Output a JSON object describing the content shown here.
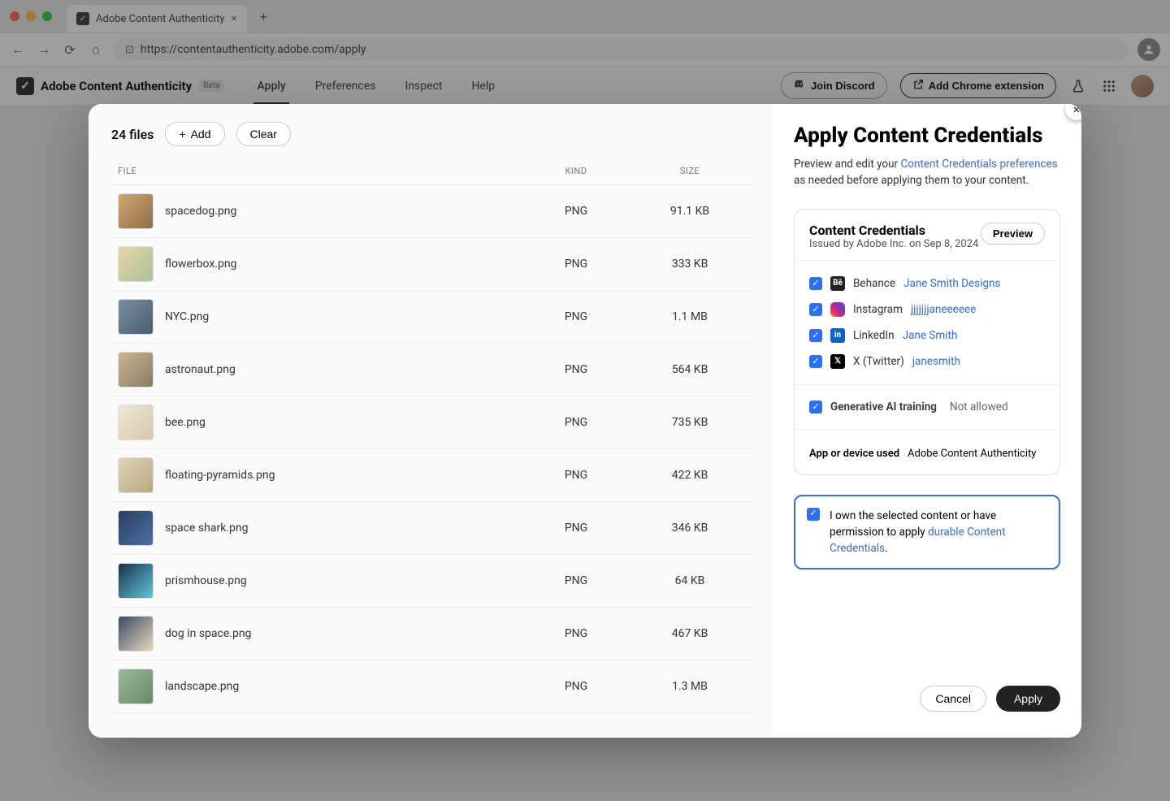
{
  "browser": {
    "tab_title": "Adobe Content Authenticity",
    "url": "https://contentauthenticity.adobe.com/apply"
  },
  "app": {
    "brand": "Adobe Content Authenticity",
    "beta": "Beta",
    "nav": [
      "Apply",
      "Preferences",
      "Inspect",
      "Help"
    ],
    "active_nav_index": 0,
    "join_discord": "Join Discord",
    "add_ext": "Add Chrome extension"
  },
  "modal": {
    "file_count": "24 files",
    "add_label": "Add",
    "clear_label": "Clear",
    "columns": {
      "file": "FILE",
      "kind": "KIND",
      "size": "SIZE"
    },
    "files": [
      {
        "name": "spacedog.png",
        "kind": "PNG",
        "size": "91.1 KB"
      },
      {
        "name": "flowerbox.png",
        "kind": "PNG",
        "size": "333 KB"
      },
      {
        "name": "NYC.png",
        "kind": "PNG",
        "size": "1.1 MB"
      },
      {
        "name": "astronaut.png",
        "kind": "PNG",
        "size": "564 KB"
      },
      {
        "name": "bee.png",
        "kind": "PNG",
        "size": "735 KB"
      },
      {
        "name": "floating-pyramids.png",
        "kind": "PNG",
        "size": "422 KB"
      },
      {
        "name": "space shark.png",
        "kind": "PNG",
        "size": "346 KB"
      },
      {
        "name": "prismhouse.png",
        "kind": "PNG",
        "size": "64 KB"
      },
      {
        "name": "dog in space.png",
        "kind": "PNG",
        "size": "467 KB"
      },
      {
        "name": "landscape.png",
        "kind": "PNG",
        "size": "1.3 MB"
      }
    ],
    "right": {
      "title": "Apply Content Credentials",
      "sub_prefix": "Preview and edit your ",
      "sub_link": "Content Credentials preferences",
      "sub_suffix": " as needed before applying them to your content.",
      "card_title": "Content Credentials",
      "issuer": "Issued by Adobe Inc. on Sep 8, 2024",
      "preview": "Preview",
      "socials": [
        {
          "platform": "Behance",
          "handle": "Jane Smith Designs",
          "icon": "be"
        },
        {
          "platform": "Instagram",
          "handle": "jjjjjjjaneeeeee",
          "icon": "ig"
        },
        {
          "platform": "LinkedIn",
          "handle": "Jane Smith",
          "icon": "li"
        },
        {
          "platform": "X (Twitter)",
          "handle": "janesmith",
          "icon": "x"
        }
      ],
      "genai_label": "Generative AI training",
      "genai_value": "Not allowed",
      "app_used_label": "App or device used",
      "app_used_value": "Adobe Content Authenticity",
      "own_prefix": "I own the selected content or have permission to apply ",
      "own_link": "durable Content Credentials",
      "own_suffix": ".",
      "cancel": "Cancel",
      "apply": "Apply"
    }
  }
}
